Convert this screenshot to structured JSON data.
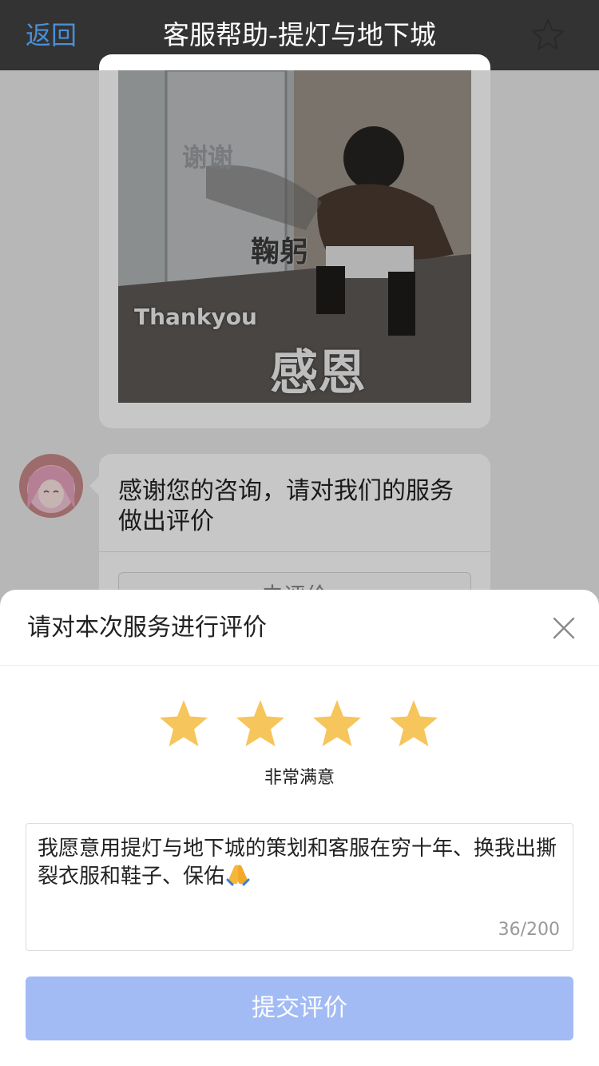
{
  "navbar": {
    "back_label": "返回",
    "title": "客服帮助-提灯与地下城",
    "icon": "star-outline-icon"
  },
  "chat": {
    "sticker": {
      "text_1": "谢谢",
      "text_2": "鞠躬",
      "text_3": "Thankyou",
      "text_4": "感恩"
    },
    "message": {
      "text": "感谢您的咨询，请对我们的服务做出评价",
      "button_label": "去评价"
    }
  },
  "rating_sheet": {
    "title": "请对本次服务进行评价",
    "close_icon": "close-icon",
    "stars_filled": 4,
    "star_color": "#f6c55b",
    "rating_label": "非常满意",
    "comment": "我愿意用提灯与地下城的策划和客服在穷十年、换我出撕裂衣服和鞋子、保佑",
    "comment_emoji": "folded-hands-icon",
    "char_count": "36/200",
    "submit_label": "提交评价",
    "submit_color": "#a2bbf5"
  },
  "colors": {
    "navbar_bg": "#333333",
    "back_link": "#4a8fd6"
  }
}
